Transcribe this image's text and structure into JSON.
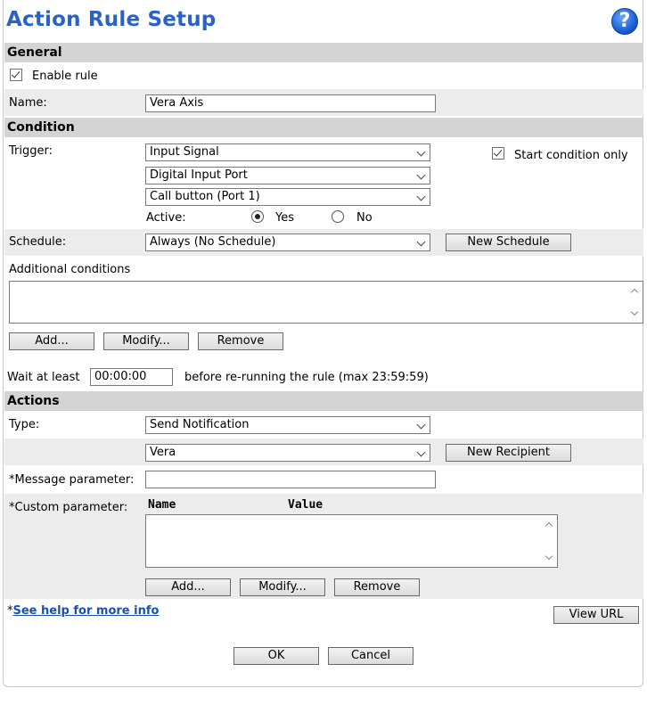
{
  "title": "Action Rule Setup",
  "help_glyph": "?",
  "general": {
    "section_label": "General",
    "enable_rule_label": "Enable rule",
    "enable_rule_checked": true,
    "name_label": "Name:",
    "name_value": "Vera Axis"
  },
  "condition": {
    "section_label": "Condition",
    "trigger_label": "Trigger:",
    "trigger_value": "Input Signal",
    "port_type_value": "Digital Input Port",
    "port_value": "Call button (Port 1)",
    "start_condition_label": "Start condition only",
    "start_condition_checked": true,
    "active_label": "Active:",
    "active_yes": "Yes",
    "active_no": "No",
    "active_selected": "Yes",
    "schedule_label": "Schedule:",
    "schedule_value": "Always (No Schedule)",
    "new_schedule_button": "New Schedule",
    "additional_label": "Additional conditions",
    "add_button": "Add...",
    "modify_button": "Modify...",
    "remove_button": "Remove",
    "wait_label": "Wait at least",
    "wait_value": "00:00:00",
    "wait_suffix": "before re-running the rule (max 23:59:59)"
  },
  "actions": {
    "section_label": "Actions",
    "type_label": "Type:",
    "type_value": "Send Notification",
    "recipient_value": "Vera",
    "new_recipient_button": "New Recipient",
    "message_label": "*Message parameter:",
    "message_value": "",
    "custom_label": "*Custom parameter:",
    "col_name": "Name",
    "col_value": "Value",
    "add_button": "Add...",
    "modify_button": "Modify...",
    "remove_button": "Remove"
  },
  "footer": {
    "help_prefix": "*",
    "help_link": "See help for more info",
    "view_url_button": "View URL",
    "ok_button": "OK",
    "cancel_button": "Cancel"
  }
}
